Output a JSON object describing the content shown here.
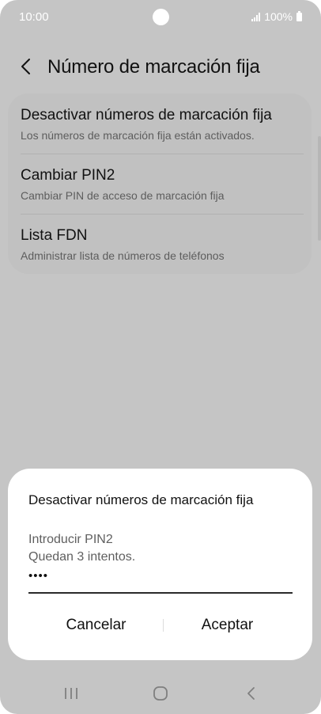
{
  "status_bar": {
    "time": "10:00",
    "battery": "100%"
  },
  "header": {
    "title": "Número de marcación fija"
  },
  "settings": {
    "items": [
      {
        "title": "Desactivar números de marcación fija",
        "subtitle": "Los números de marcación fija están activados."
      },
      {
        "title": "Cambiar PIN2",
        "subtitle": "Cambiar PIN de acceso de marcación fija"
      },
      {
        "title": "Lista FDN",
        "subtitle": "Administrar lista de números de teléfonos"
      }
    ]
  },
  "dialog": {
    "title": "Desactivar números de marcación fija",
    "prompt": "Introducir PIN2",
    "attempts": "Quedan 3 intentos.",
    "pin_value": "••••",
    "cancel_label": "Cancelar",
    "accept_label": "Aceptar"
  },
  "icons": {
    "back": "chevron-left-icon",
    "nav_recents": "recents-icon",
    "nav_home": "home-icon",
    "nav_back": "nav-back-icon"
  },
  "colors": {
    "overlay_background": "#c5c5c5",
    "dialog_background": "#ffffff",
    "text_primary": "#111111"
  }
}
